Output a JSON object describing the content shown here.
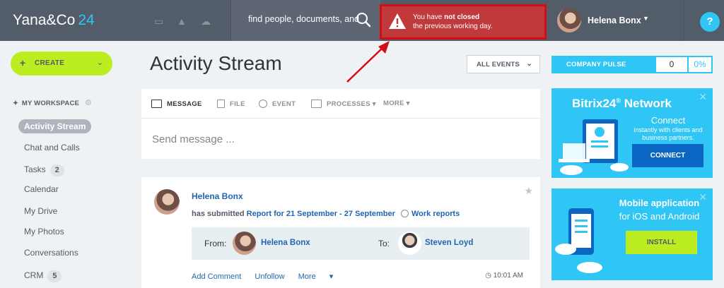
{
  "header": {
    "logo_name": "Yana&Co",
    "logo_num": "24",
    "search_placeholder": "find people, documents, and",
    "warning_line1_prefix": "You have ",
    "warning_line1_bold": "not closed",
    "warning_line2": "the previous working day.",
    "user_name": "Helena Bonx",
    "help": "?"
  },
  "sidebar": {
    "create_label": "CREATE",
    "workspace_title": "MY WORKSPACE",
    "items": [
      {
        "label": "Activity Stream"
      },
      {
        "label": "Chat and Calls"
      },
      {
        "label": "Tasks",
        "count": "2"
      },
      {
        "label": "Calendar"
      },
      {
        "label": "My Drive"
      },
      {
        "label": "My Photos"
      },
      {
        "label": "Conversations"
      },
      {
        "label": "CRM",
        "count": "5"
      }
    ]
  },
  "main": {
    "title": "Activity Stream",
    "filter_label": "ALL EVENTS",
    "tabs": [
      "MESSAGE",
      "FILE",
      "EVENT",
      "PROCESSES",
      "MORE"
    ],
    "composer_placeholder": "Send message ...",
    "post": {
      "author": "Helena Bonx",
      "action": "has submitted",
      "report": "Report for 21 September - 27 September",
      "category": "Work reports",
      "from_label": "From:",
      "from_name": "Helena Bonx",
      "to_label": "To:",
      "to_name": "Steven Loyd",
      "add_comment": "Add Comment",
      "unfollow": "Unfollow",
      "more": "More",
      "time": "10:01 AM"
    }
  },
  "right": {
    "pulse_label": "COMPANY PULSE",
    "pulse_value": "0",
    "pulse_percent": "0%",
    "network": {
      "title_a": "Bitrix",
      "title_b": "24",
      "title_c": "Network",
      "subtitle": "Connect",
      "desc": "instantly with clients and business partners.",
      "button": "CONNECT"
    },
    "mobile": {
      "title": "Mobile application",
      "subtitle": "for iOS and Android",
      "button": "INSTALL"
    }
  },
  "colors": {
    "header_bg": "#535c69",
    "accent_blue": "#2fc6f6",
    "create_green": "#bbed21",
    "warning_red": "#c0393b",
    "link_blue": "#2067b0"
  }
}
